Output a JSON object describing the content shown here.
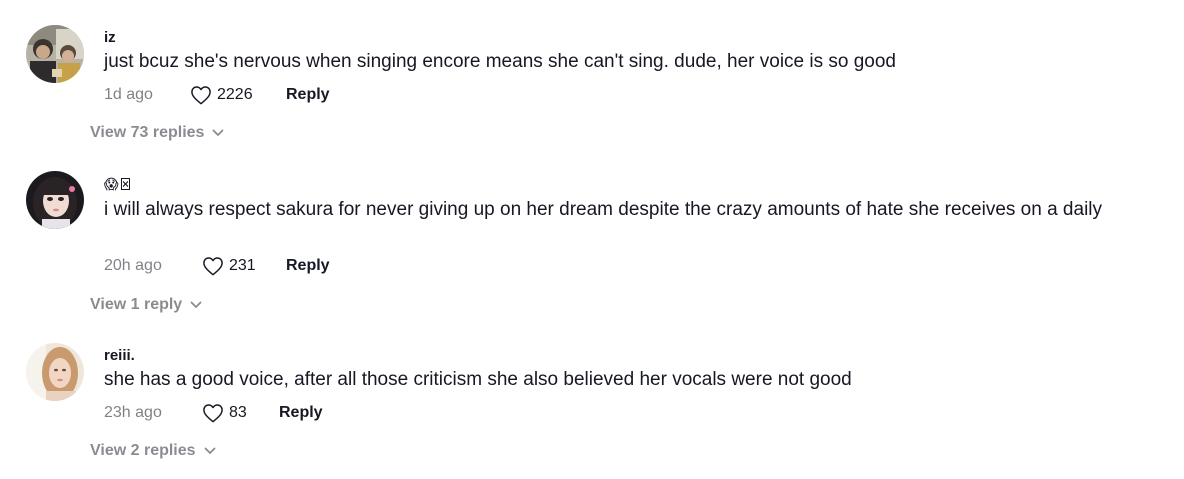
{
  "comments": [
    {
      "username": "iz",
      "text": "just bcuz she's nervous when singing encore means she can't sing. dude, her voice is so good",
      "time": "1d ago",
      "likes": "2226",
      "reply_label": "Reply",
      "view_replies": "View 73 replies"
    },
    {
      "username_emoji": "😱",
      "username": "",
      "text": "i will always respect sakura for never giving up on her dream despite the crazy amounts of hate she receives on a daily",
      "time": "20h ago",
      "likes": "231",
      "reply_label": "Reply",
      "view_replies": "View 1 reply"
    },
    {
      "username": "reiii.",
      "text": "she has a good voice, after all those criticism she also believed her vocals were not good",
      "time": "23h ago",
      "likes": "83",
      "reply_label": "Reply",
      "view_replies": "View 2 replies"
    }
  ],
  "icons": {
    "heart": "heart-outline-icon",
    "chevron": "chevron-down-icon"
  },
  "colors": {
    "text_primary": "#161823",
    "text_secondary": "#8a8b91"
  }
}
